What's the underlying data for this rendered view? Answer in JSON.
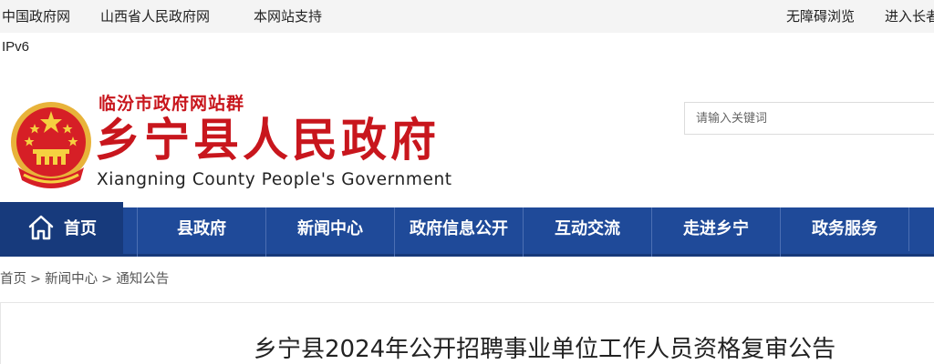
{
  "top_links": {
    "china_gov": "中国政府网",
    "shanxi_gov": "山西省人民政府网",
    "support": "本网站支持",
    "accessible": "无障碍浏览",
    "elder": "进入长者"
  },
  "ipv6": "IPv6",
  "header": {
    "group": "临汾市政府网站群",
    "title": "乡宁县人民政府",
    "subtitle_en": "Xiangning County People's Government"
  },
  "search": {
    "placeholder": "请输入关键词"
  },
  "nav": {
    "home": "首页",
    "items": [
      "县政府",
      "新闻中心",
      "政府信息公开",
      "互动交流",
      "走进乡宁",
      "政务服务"
    ]
  },
  "breadcrumb": [
    "首页",
    "新闻中心",
    "通知公告"
  ],
  "breadcrumb_sep": ">",
  "article": {
    "title": "乡宁县2024年公开招聘事业单位工作人员资格复审公告"
  },
  "colors": {
    "brand_red": "#c8161d",
    "nav_blue": "#1f4a99",
    "nav_home": "#173a7c"
  }
}
